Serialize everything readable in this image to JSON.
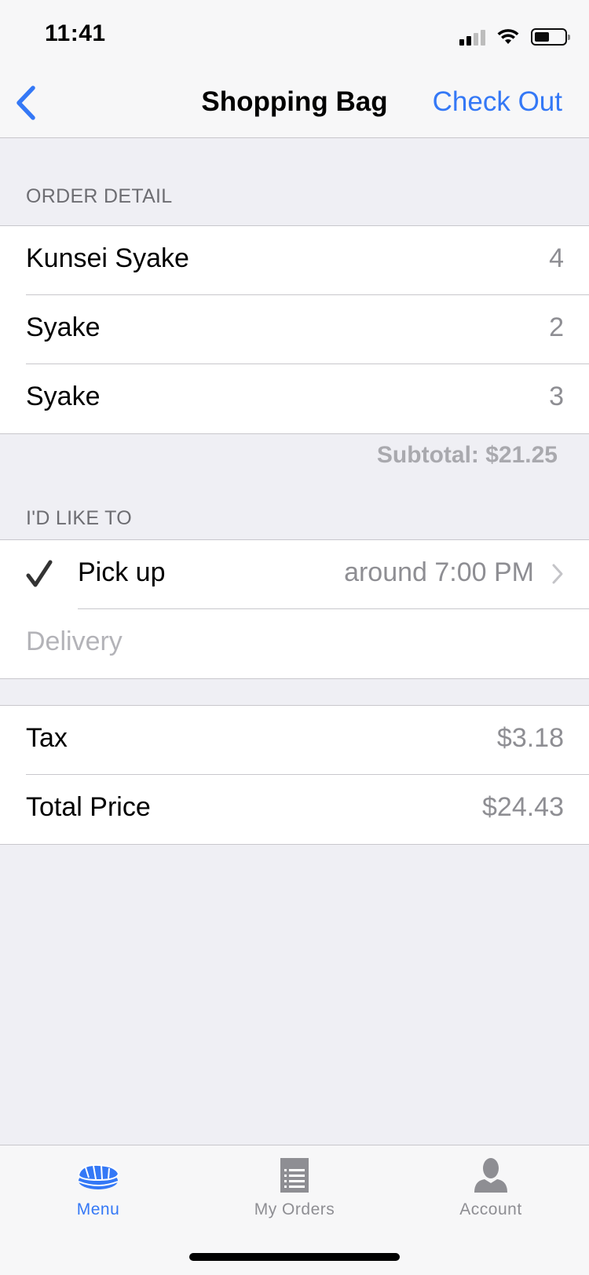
{
  "status_bar": {
    "time": "11:41"
  },
  "nav": {
    "title": "Shopping Bag",
    "action_label": "Check Out"
  },
  "order_detail": {
    "header": "ORDER DETAIL",
    "items": [
      {
        "name": "Kunsei Syake",
        "qty": "4"
      },
      {
        "name": "Syake",
        "qty": "2"
      },
      {
        "name": "Syake",
        "qty": "3"
      }
    ],
    "subtotal": "Subtotal: $21.25"
  },
  "preference": {
    "header": "I'D LIKE TO",
    "pickup_label": "Pick up",
    "pickup_time": "around 7:00 PM",
    "delivery_label": "Delivery"
  },
  "totals": {
    "tax_label": "Tax",
    "tax_value": "$3.18",
    "total_label": "Total Price",
    "total_value": "$24.43"
  },
  "tab_bar": {
    "tabs": [
      {
        "label": "Menu",
        "icon": "sushi-icon"
      },
      {
        "label": "My Orders",
        "icon": "receipt-list-icon"
      },
      {
        "label": "Account",
        "icon": "person-icon"
      }
    ]
  },
  "colors": {
    "accent": "#3478F6",
    "inactive_tab": "#8E8E93",
    "background": "#EFEFF4"
  }
}
